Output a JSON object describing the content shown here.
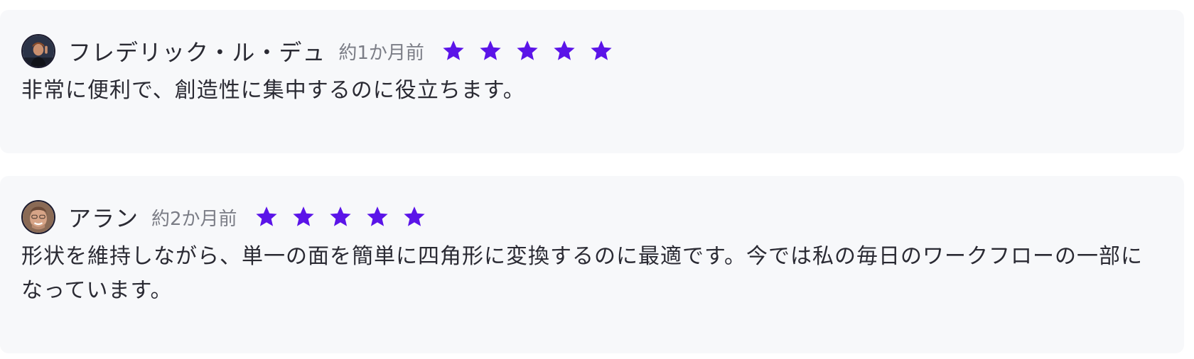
{
  "reviews": [
    {
      "name": "フレデリック・ル・デュ",
      "date": "約1か月前",
      "rating": 5,
      "text": "非常に便利で、創造性に集中するのに役立ちます。"
    },
    {
      "name": "アラン",
      "date": "約2か月前",
      "rating": 5,
      "text": "形状を維持しながら、単一の面を簡単に四角形に変換するのに最適です。今では私の毎日のワークフローの一部になっています。"
    }
  ],
  "colors": {
    "star": "#5b14e8",
    "card_background": "#f7f8fa",
    "text": "#2a2a33",
    "muted_text": "#7b7d86"
  },
  "icons": {
    "rating_star": "star-icon"
  }
}
